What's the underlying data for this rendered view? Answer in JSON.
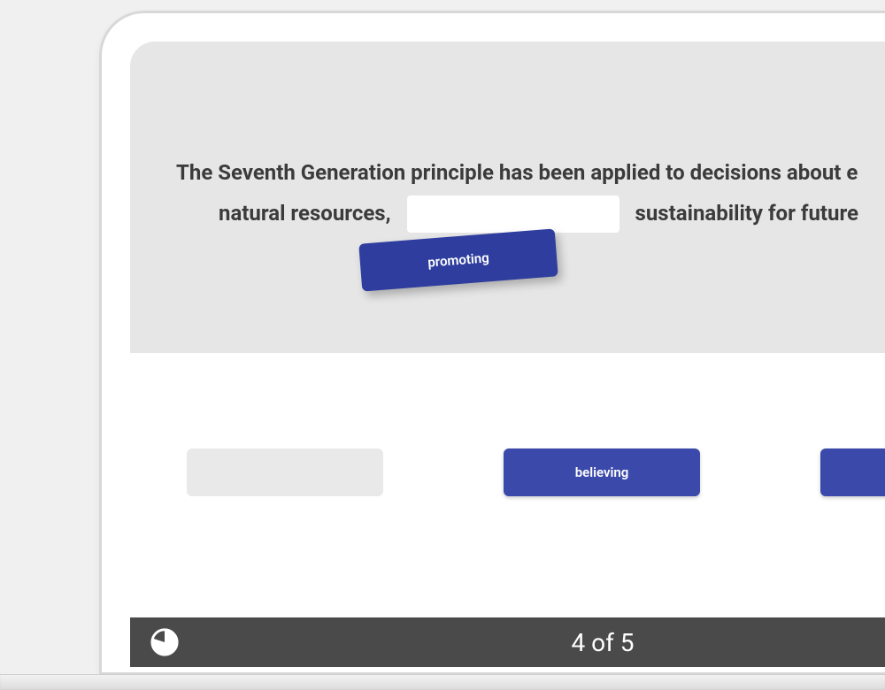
{
  "question": {
    "line1": "The Seventh Generation principle has been applied to decisions about e",
    "line2_before": "natural resources,",
    "line2_after": "sustainability for future"
  },
  "dragged_chip": {
    "label": "promoting"
  },
  "answer_bank": {
    "slots": [
      {
        "label": "",
        "empty": true
      },
      {
        "label": "believing",
        "empty": false
      },
      {
        "label": "",
        "empty": false
      }
    ]
  },
  "footer": {
    "progress_label": "4 of 5",
    "progress_fraction": 0.8
  },
  "colors": {
    "chip_bg": "#3a49aa",
    "chip_dragged_bg": "#2f3e9e",
    "question_bg": "#e6e6e6",
    "footer_bg": "#4a4a4a"
  }
}
